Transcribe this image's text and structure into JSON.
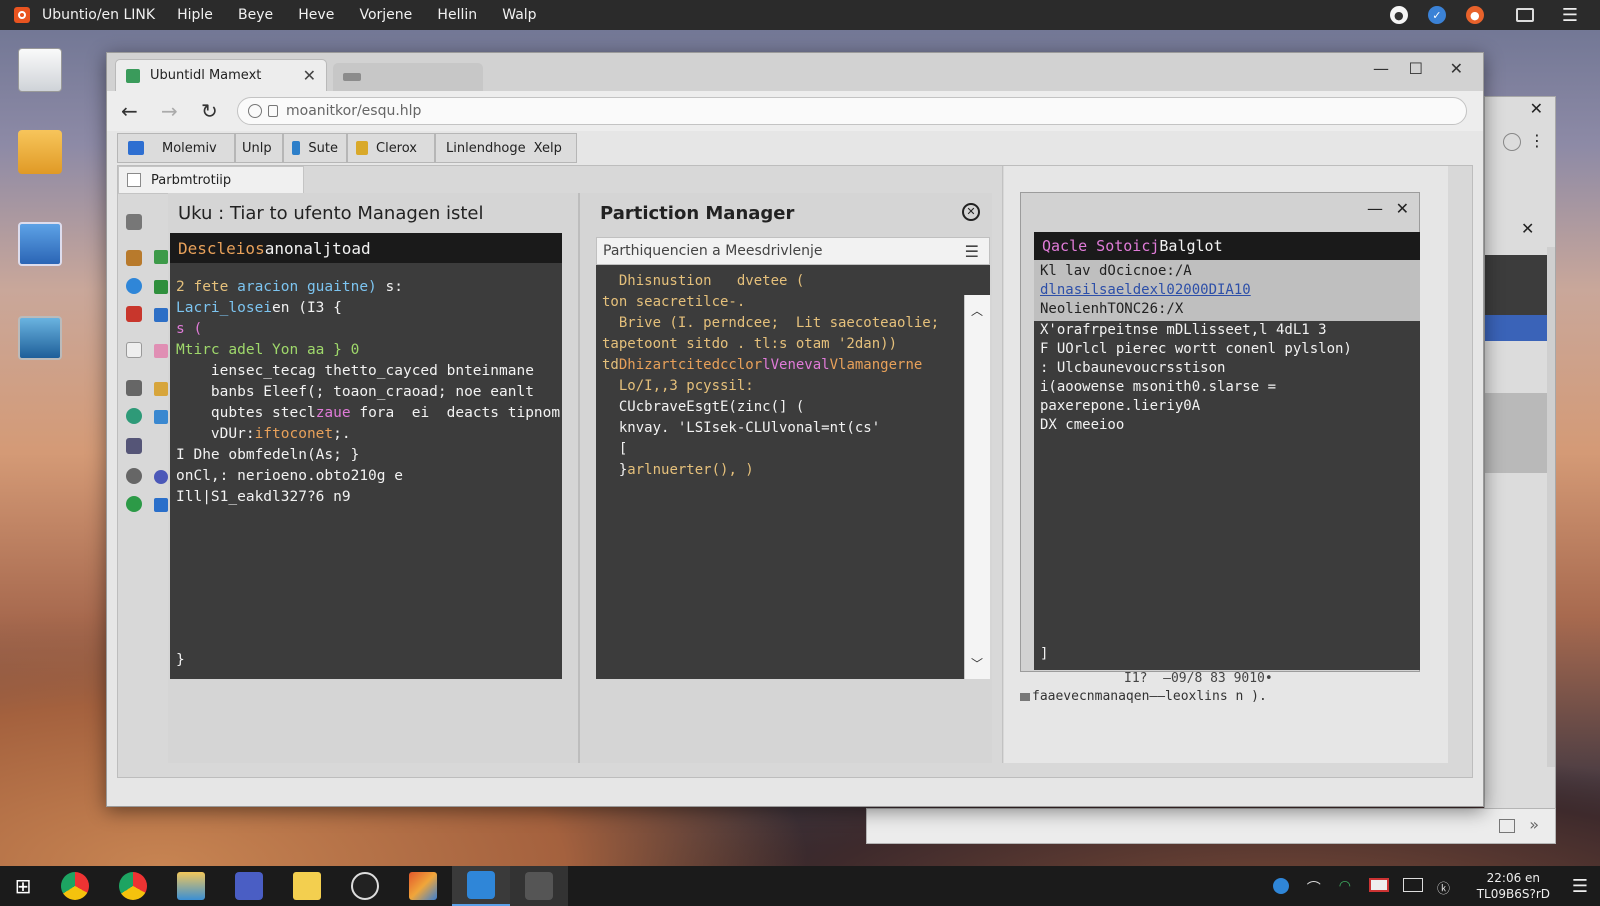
{
  "topbar": {
    "app_name": "Ubuntio/en LINK",
    "menu": [
      "Hiple",
      "Beye",
      "Heve",
      "Vorjene",
      "Hellin",
      "Walp"
    ]
  },
  "browser": {
    "tab_title": "Ubuntidl Mamext",
    "url": "moanitkor/esqu.hlp",
    "toolbar": [
      "Molemiv",
      "Unlp",
      "Sute",
      "Clerox",
      "Linlendhoge",
      "Xelp"
    ],
    "crumb_tab": "Parbmtrotiip"
  },
  "panel1": {
    "title": "Uku : Tiar to ufento Managen istel",
    "terminal_header": [
      "Descleios",
      " anonal ",
      "jtoad"
    ],
    "lines": [
      [
        "2 fete ",
        "aracion guaitne)",
        " s:"
      ],
      [
        "Lacri_losei",
        "en (I3 {"
      ],
      [
        ""
      ],
      [
        "s ("
      ],
      [
        "Mtirc adel Yon aa } 0"
      ],
      [
        "    iensec_tecag thetto_cayced bnteinmane"
      ],
      [
        "    banbs Eleef(; toaon_craoad; noe eanlt"
      ],
      [
        "    qubtes stecl",
        "zaue",
        " fora  ei  deacts tipnom"
      ],
      [
        "    vDUr:",
        "iftoconet",
        ";."
      ],
      [
        ""
      ],
      [
        "I Dhe obmfedeln(As; }"
      ],
      [
        "onCl,: nerioeno.obto210g e"
      ],
      [
        "Ill|S1_eakdl327?6 n9"
      ]
    ],
    "closing": "}"
  },
  "panel2": {
    "title": "Partiction Manager",
    "subheader": "Parthiquencien a Meesdrivlenje",
    "lines": [
      [
        "  Dhisnustion   dvetee ("
      ],
      [
        "ton seacretilce-."
      ],
      [
        "  Brive (I. perndcee;  Lit saecoteaolie;"
      ],
      [
        "tapetoont sitdo . tl:s otam '2dan))"
      ],
      [
        "td",
        "Dhizartcitedcclor",
        "lVeneval",
        "Vlamangerne"
      ],
      [
        "  Lo/I,,3 pcyssil:",
        ""
      ],
      [
        ""
      ],
      [
        "  ",
        "CUcbraveEsgtE(zinc(] ("
      ],
      [
        "  knvay. ",
        "'LSIsek-CLUlvonal=nt(cs'"
      ],
      [
        "  ["
      ],
      [
        "  }",
        "arlnuerter(), )"
      ]
    ]
  },
  "panel3": {
    "header": [
      "Qacle Sotoicj",
      " Balglot"
    ],
    "selected_lines": [
      "Kl lav dOcicnoe:/A",
      "dlnasilsaeldexl02000DIA10",
      "NeolienhTONC26:/X"
    ],
    "lines": [
      "X'orafrpeitnse mDLlisseet,l 4dL1 3",
      "F UOrlcl pierec wortt conenl pylslon)",
      "",
      ": Ulcbaunevoucrsstison",
      "i(aoowense msonith0.slarse =",
      "paxerepone.lieriy0A",
      "DX cmeeioo"
    ],
    "closing": "]",
    "below_lines": [
      "I1?  –09/8 83 9010•",
      "faaevecnmanaqen——leoxlins n )."
    ]
  },
  "clock": {
    "time": "22:06 en",
    "date": "TL09B6S?rD"
  },
  "colors": {
    "accent": "#e95420",
    "terminal_bg": "#3c3c3c",
    "selection": "#3a63b8"
  }
}
